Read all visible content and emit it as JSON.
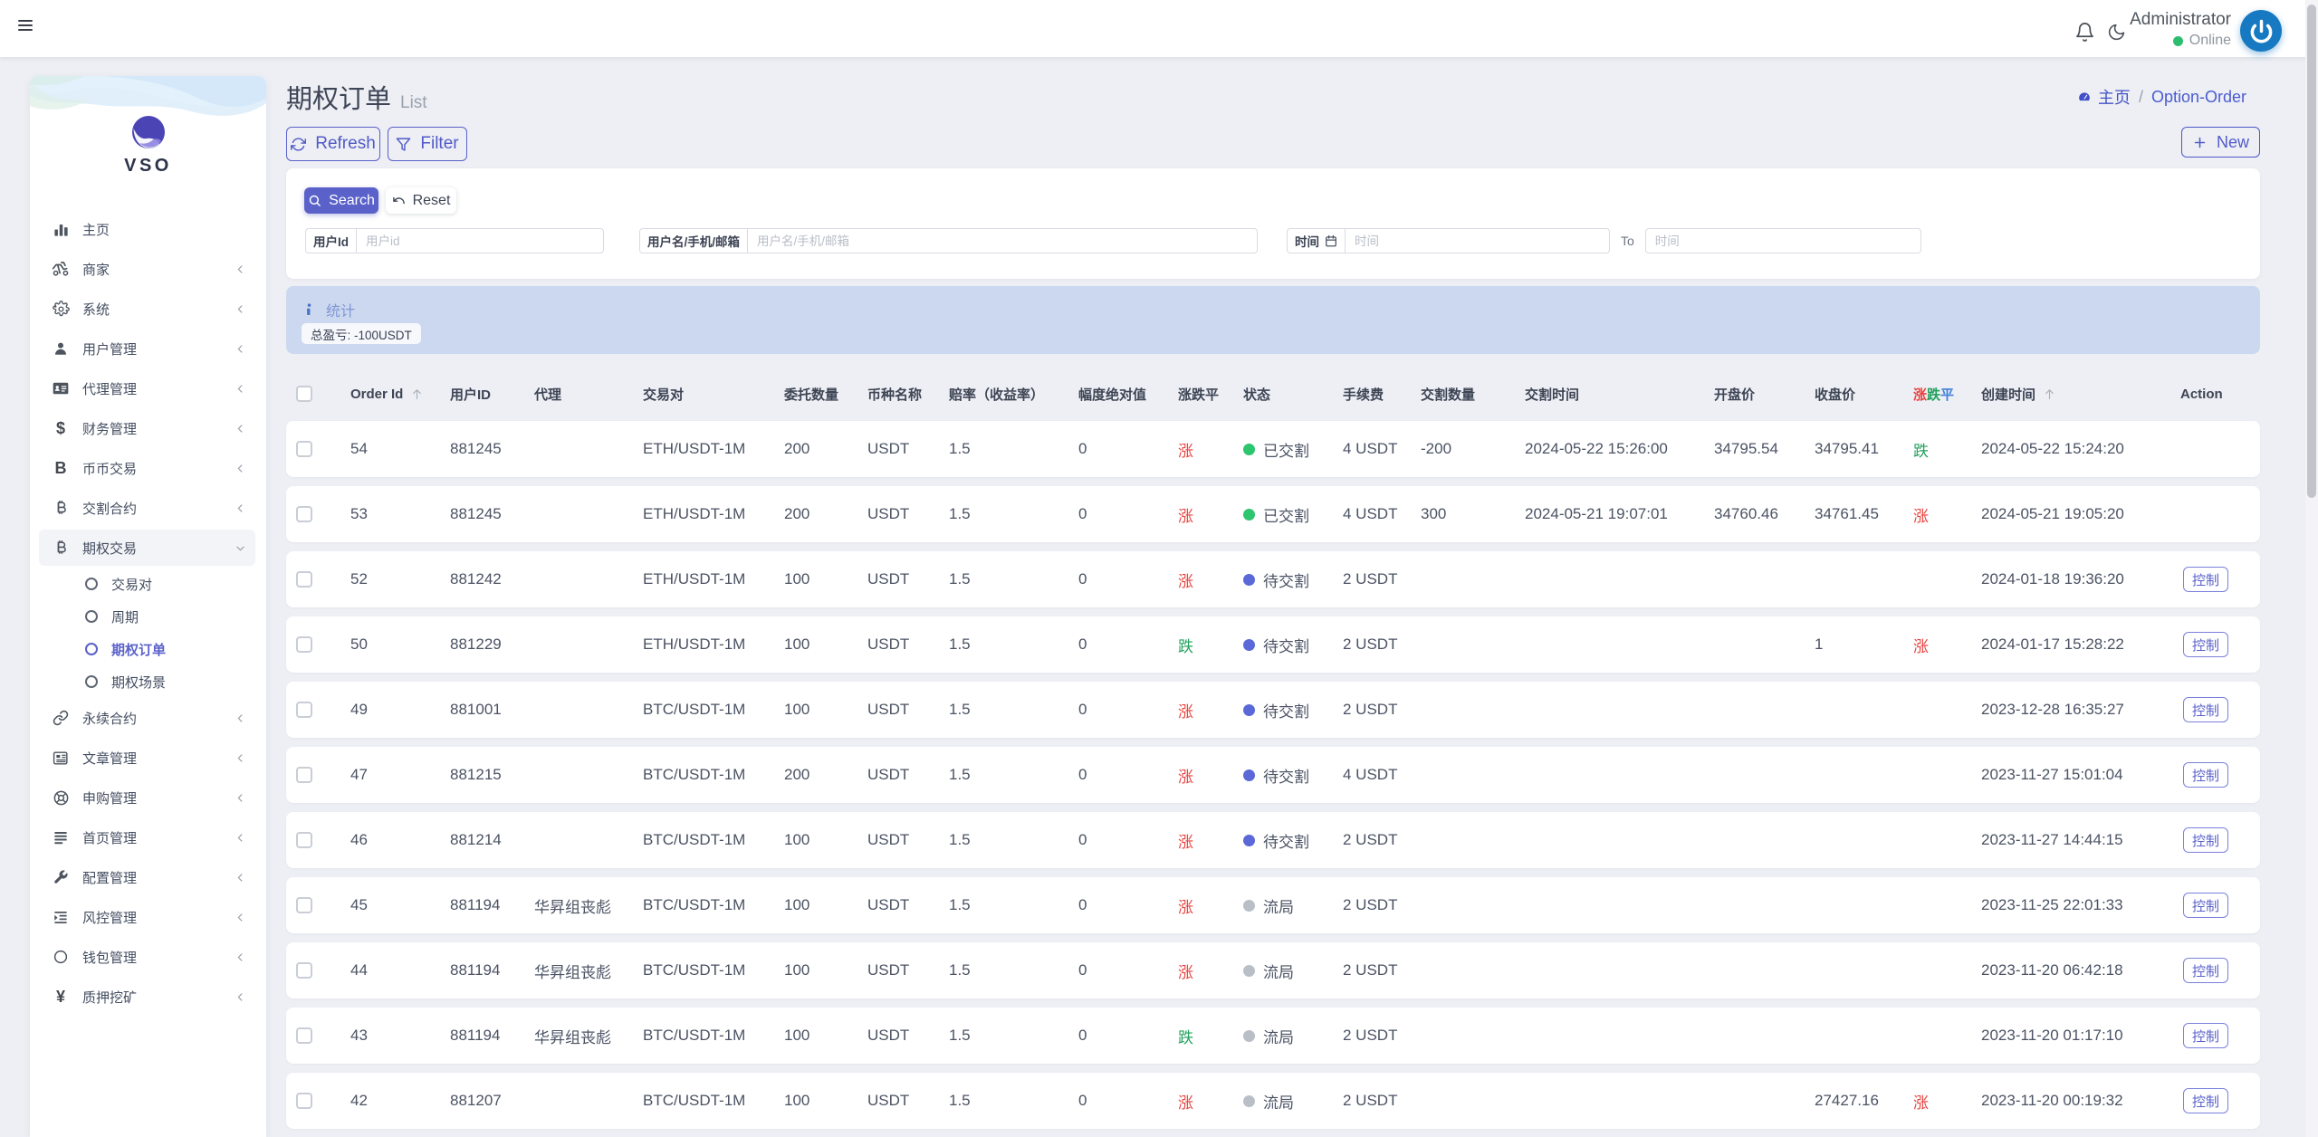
{
  "colors": {
    "primary": "#5a61c9",
    "up_red": "#e8433e",
    "down_green": "#21a15c",
    "flat_blue": "#3f7fd8",
    "status_delivered_dot": "#2ec56f",
    "status_pending_dot": "#5a68d8",
    "status_void_dot": "#b9bfc7",
    "stats_band_bg": "#ccd8ef",
    "avatar_blue": "#1779c1",
    "online_green": "#2dbd6e"
  },
  "topbar": {
    "user_name": "Administrator",
    "user_status": "Online"
  },
  "sidebar": {
    "brand": "VSO",
    "items": [
      {
        "label": "主页",
        "icon": "chart-icon",
        "chevron": false
      },
      {
        "label": "商家",
        "icon": "merchant-icon",
        "chevron": true
      },
      {
        "label": "系统",
        "icon": "gear-icon",
        "chevron": true
      },
      {
        "label": "用户管理",
        "icon": "user-icon",
        "chevron": true
      },
      {
        "label": "代理管理",
        "icon": "idcard-icon",
        "chevron": true
      },
      {
        "label": "财务管理",
        "icon": "dollar-icon",
        "chevron": true
      },
      {
        "label": "币币交易",
        "icon": "letter-b-icon",
        "chevron": true
      },
      {
        "label": "交割合约",
        "icon": "bitcoin-icon",
        "chevron": true
      },
      {
        "label": "期权交易",
        "icon": "bitcoin-icon",
        "chevron": true,
        "expanded": true,
        "children": [
          {
            "label": "交易对",
            "active": false
          },
          {
            "label": "周期",
            "active": false
          },
          {
            "label": "期权订单",
            "active": true
          },
          {
            "label": "期权场景",
            "active": false
          }
        ]
      },
      {
        "label": "永续合约",
        "icon": "link-icon",
        "chevron": true
      },
      {
        "label": "文章管理",
        "icon": "newspaper-icon",
        "chevron": true
      },
      {
        "label": "申购管理",
        "icon": "lifebuoy-icon",
        "chevron": true
      },
      {
        "label": "首页管理",
        "icon": "lines-icon",
        "chevron": true
      },
      {
        "label": "配置管理",
        "icon": "wrench-icon",
        "chevron": true
      },
      {
        "label": "风控管理",
        "icon": "indent-icon",
        "chevron": true
      },
      {
        "label": "钱包管理",
        "icon": "circle-icon",
        "chevron": true
      },
      {
        "label": "质押挖矿",
        "icon": "yen-icon",
        "chevron": true
      }
    ]
  },
  "page": {
    "title": "期权订单",
    "subtitle": "List",
    "breadcrumb": {
      "home": "主页",
      "separator": "/",
      "current": "Option-Order"
    }
  },
  "toolbar": {
    "refresh_label": "Refresh",
    "filter_label": "Filter",
    "new_label": "New"
  },
  "search": {
    "search_label": "Search",
    "reset_label": "Reset",
    "user_id": {
      "label": "用户Id",
      "placeholder": "用户id",
      "value": ""
    },
    "user_name": {
      "label": "用户名/手机/邮箱",
      "placeholder": "用户名/手机/邮箱",
      "value": ""
    },
    "time_from": {
      "label": "时间",
      "placeholder": "时间",
      "value": ""
    },
    "time_to_label": "To",
    "time_to": {
      "placeholder": "时间",
      "value": ""
    }
  },
  "stats": {
    "title": "统计",
    "total_pnl_badge": "总盈亏: -100USDT"
  },
  "table": {
    "headers": {
      "order_id": "Order Id",
      "user_id": "用户ID",
      "agent": "代理",
      "pair": "交易对",
      "amount": "委托数量",
      "coin": "币种名称",
      "odds": "赔率（收益率）",
      "amplitude": "幅度绝对值",
      "updown": "涨跌平",
      "status": "状态",
      "fee": "手续费",
      "delivery_qty": "交割数量",
      "delivery_time": "交割时间",
      "open_price": "开盘价",
      "close_price": "收盘价",
      "updown2_up": "涨",
      "updown2_down": "跌",
      "updown2_flat": "平",
      "created": "创建时间",
      "action": "Action"
    },
    "action_button_label": "控制",
    "rows": [
      {
        "order_id": "54",
        "user_id": "881245",
        "agent": "",
        "pair": "ETH/USDT-1M",
        "amount": "200",
        "coin": "USDT",
        "odds": "1.5",
        "amplitude": "0",
        "updown": "涨",
        "updown_trend": "up",
        "status": "已交割",
        "status_kind": "delivered",
        "fee": "4 USDT",
        "delivery_qty": "-200",
        "delivery_time": "2024-05-22 15:26:00",
        "open_price": "34795.54",
        "close_price": "34795.41",
        "updown2": "跌",
        "updown2_trend": "down",
        "created": "2024-05-22 15:24:20",
        "has_action": false
      },
      {
        "order_id": "53",
        "user_id": "881245",
        "agent": "",
        "pair": "ETH/USDT-1M",
        "amount": "200",
        "coin": "USDT",
        "odds": "1.5",
        "amplitude": "0",
        "updown": "涨",
        "updown_trend": "up",
        "status": "已交割",
        "status_kind": "delivered",
        "fee": "4 USDT",
        "delivery_qty": "300",
        "delivery_time": "2024-05-21 19:07:01",
        "open_price": "34760.46",
        "close_price": "34761.45",
        "updown2": "涨",
        "updown2_trend": "up",
        "created": "2024-05-21 19:05:20",
        "has_action": false
      },
      {
        "order_id": "52",
        "user_id": "881242",
        "agent": "",
        "pair": "ETH/USDT-1M",
        "amount": "100",
        "coin": "USDT",
        "odds": "1.5",
        "amplitude": "0",
        "updown": "涨",
        "updown_trend": "up",
        "status": "待交割",
        "status_kind": "pending",
        "fee": "2 USDT",
        "delivery_qty": "",
        "delivery_time": "",
        "open_price": "",
        "close_price": "",
        "updown2": "",
        "updown2_trend": "",
        "created": "2024-01-18 19:36:20",
        "has_action": true
      },
      {
        "order_id": "50",
        "user_id": "881229",
        "agent": "",
        "pair": "ETH/USDT-1M",
        "amount": "100",
        "coin": "USDT",
        "odds": "1.5",
        "amplitude": "0",
        "updown": "跌",
        "updown_trend": "down",
        "status": "待交割",
        "status_kind": "pending",
        "fee": "2 USDT",
        "delivery_qty": "",
        "delivery_time": "",
        "open_price": "",
        "close_price": "1",
        "updown2": "涨",
        "updown2_trend": "up",
        "created": "2024-01-17 15:28:22",
        "has_action": true
      },
      {
        "order_id": "49",
        "user_id": "881001",
        "agent": "",
        "pair": "BTC/USDT-1M",
        "amount": "100",
        "coin": "USDT",
        "odds": "1.5",
        "amplitude": "0",
        "updown": "涨",
        "updown_trend": "up",
        "status": "待交割",
        "status_kind": "pending",
        "fee": "2 USDT",
        "delivery_qty": "",
        "delivery_time": "",
        "open_price": "",
        "close_price": "",
        "updown2": "",
        "updown2_trend": "",
        "created": "2023-12-28 16:35:27",
        "has_action": true
      },
      {
        "order_id": "47",
        "user_id": "881215",
        "agent": "",
        "pair": "BTC/USDT-1M",
        "amount": "200",
        "coin": "USDT",
        "odds": "1.5",
        "amplitude": "0",
        "updown": "涨",
        "updown_trend": "up",
        "status": "待交割",
        "status_kind": "pending",
        "fee": "4 USDT",
        "delivery_qty": "",
        "delivery_time": "",
        "open_price": "",
        "close_price": "",
        "updown2": "",
        "updown2_trend": "",
        "created": "2023-11-27 15:01:04",
        "has_action": true
      },
      {
        "order_id": "46",
        "user_id": "881214",
        "agent": "",
        "pair": "BTC/USDT-1M",
        "amount": "100",
        "coin": "USDT",
        "odds": "1.5",
        "amplitude": "0",
        "updown": "涨",
        "updown_trend": "up",
        "status": "待交割",
        "status_kind": "pending",
        "fee": "2 USDT",
        "delivery_qty": "",
        "delivery_time": "",
        "open_price": "",
        "close_price": "",
        "updown2": "",
        "updown2_trend": "",
        "created": "2023-11-27 14:44:15",
        "has_action": true
      },
      {
        "order_id": "45",
        "user_id": "881194",
        "agent": "华昇组丧彪",
        "pair": "BTC/USDT-1M",
        "amount": "100",
        "coin": "USDT",
        "odds": "1.5",
        "amplitude": "0",
        "updown": "涨",
        "updown_trend": "up",
        "status": "流局",
        "status_kind": "void",
        "fee": "2 USDT",
        "delivery_qty": "",
        "delivery_time": "",
        "open_price": "",
        "close_price": "",
        "updown2": "",
        "updown2_trend": "",
        "created": "2023-11-25 22:01:33",
        "has_action": true
      },
      {
        "order_id": "44",
        "user_id": "881194",
        "agent": "华昇组丧彪",
        "pair": "BTC/USDT-1M",
        "amount": "100",
        "coin": "USDT",
        "odds": "1.5",
        "amplitude": "0",
        "updown": "涨",
        "updown_trend": "up",
        "status": "流局",
        "status_kind": "void",
        "fee": "2 USDT",
        "delivery_qty": "",
        "delivery_time": "",
        "open_price": "",
        "close_price": "",
        "updown2": "",
        "updown2_trend": "",
        "created": "2023-11-20 06:42:18",
        "has_action": true
      },
      {
        "order_id": "43",
        "user_id": "881194",
        "agent": "华昇组丧彪",
        "pair": "BTC/USDT-1M",
        "amount": "100",
        "coin": "USDT",
        "odds": "1.5",
        "amplitude": "0",
        "updown": "跌",
        "updown_trend": "down",
        "status": "流局",
        "status_kind": "void",
        "fee": "2 USDT",
        "delivery_qty": "",
        "delivery_time": "",
        "open_price": "",
        "close_price": "",
        "updown2": "",
        "updown2_trend": "",
        "created": "2023-11-20 01:17:10",
        "has_action": true
      },
      {
        "order_id": "42",
        "user_id": "881207",
        "agent": "",
        "pair": "BTC/USDT-1M",
        "amount": "100",
        "coin": "USDT",
        "odds": "1.5",
        "amplitude": "0",
        "updown": "涨",
        "updown_trend": "up",
        "status": "流局",
        "status_kind": "void",
        "fee": "2 USDT",
        "delivery_qty": "",
        "delivery_time": "",
        "open_price": "",
        "close_price": "27427.16",
        "updown2": "涨",
        "updown2_trend": "up",
        "created": "2023-11-20 00:19:32",
        "has_action": true
      }
    ]
  }
}
